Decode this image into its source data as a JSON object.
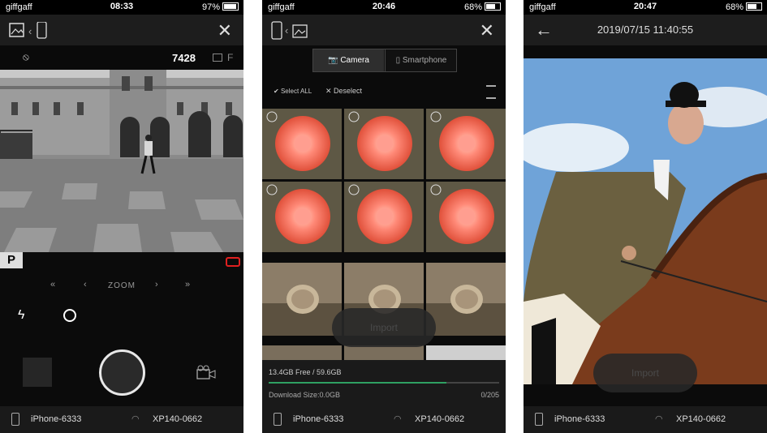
{
  "status_bar": {
    "p1": {
      "carrier": "giffgaff",
      "time": "08:33",
      "battery": "97%"
    },
    "p2": {
      "carrier": "giffgaff",
      "time": "20:46",
      "battery": "68%"
    },
    "p3": {
      "carrier": "giffgaff",
      "time": "20:47",
      "battery": "68%"
    }
  },
  "camera": {
    "shots_remaining": "7428",
    "quality": "F",
    "mode": "P",
    "zoom_label": "ZOOM"
  },
  "import_screen": {
    "tabs": [
      "Camera",
      "Smartphone"
    ],
    "select_all": "Select ALL",
    "deselect": "Deselect",
    "import_label": "Import",
    "storage_text": "13.4GB Free / 59.6GB",
    "storage_fraction": 0.77,
    "download_size": "Download Size:0.0GB",
    "count": "0/205"
  },
  "viewer": {
    "title": "2019/07/15 11:40:55",
    "import_label": "Import"
  },
  "connection": {
    "device": "iPhone-6333",
    "camera": "XP140-0662"
  },
  "colors": {
    "accent": "#2fa062",
    "record_red": "#e02020"
  }
}
